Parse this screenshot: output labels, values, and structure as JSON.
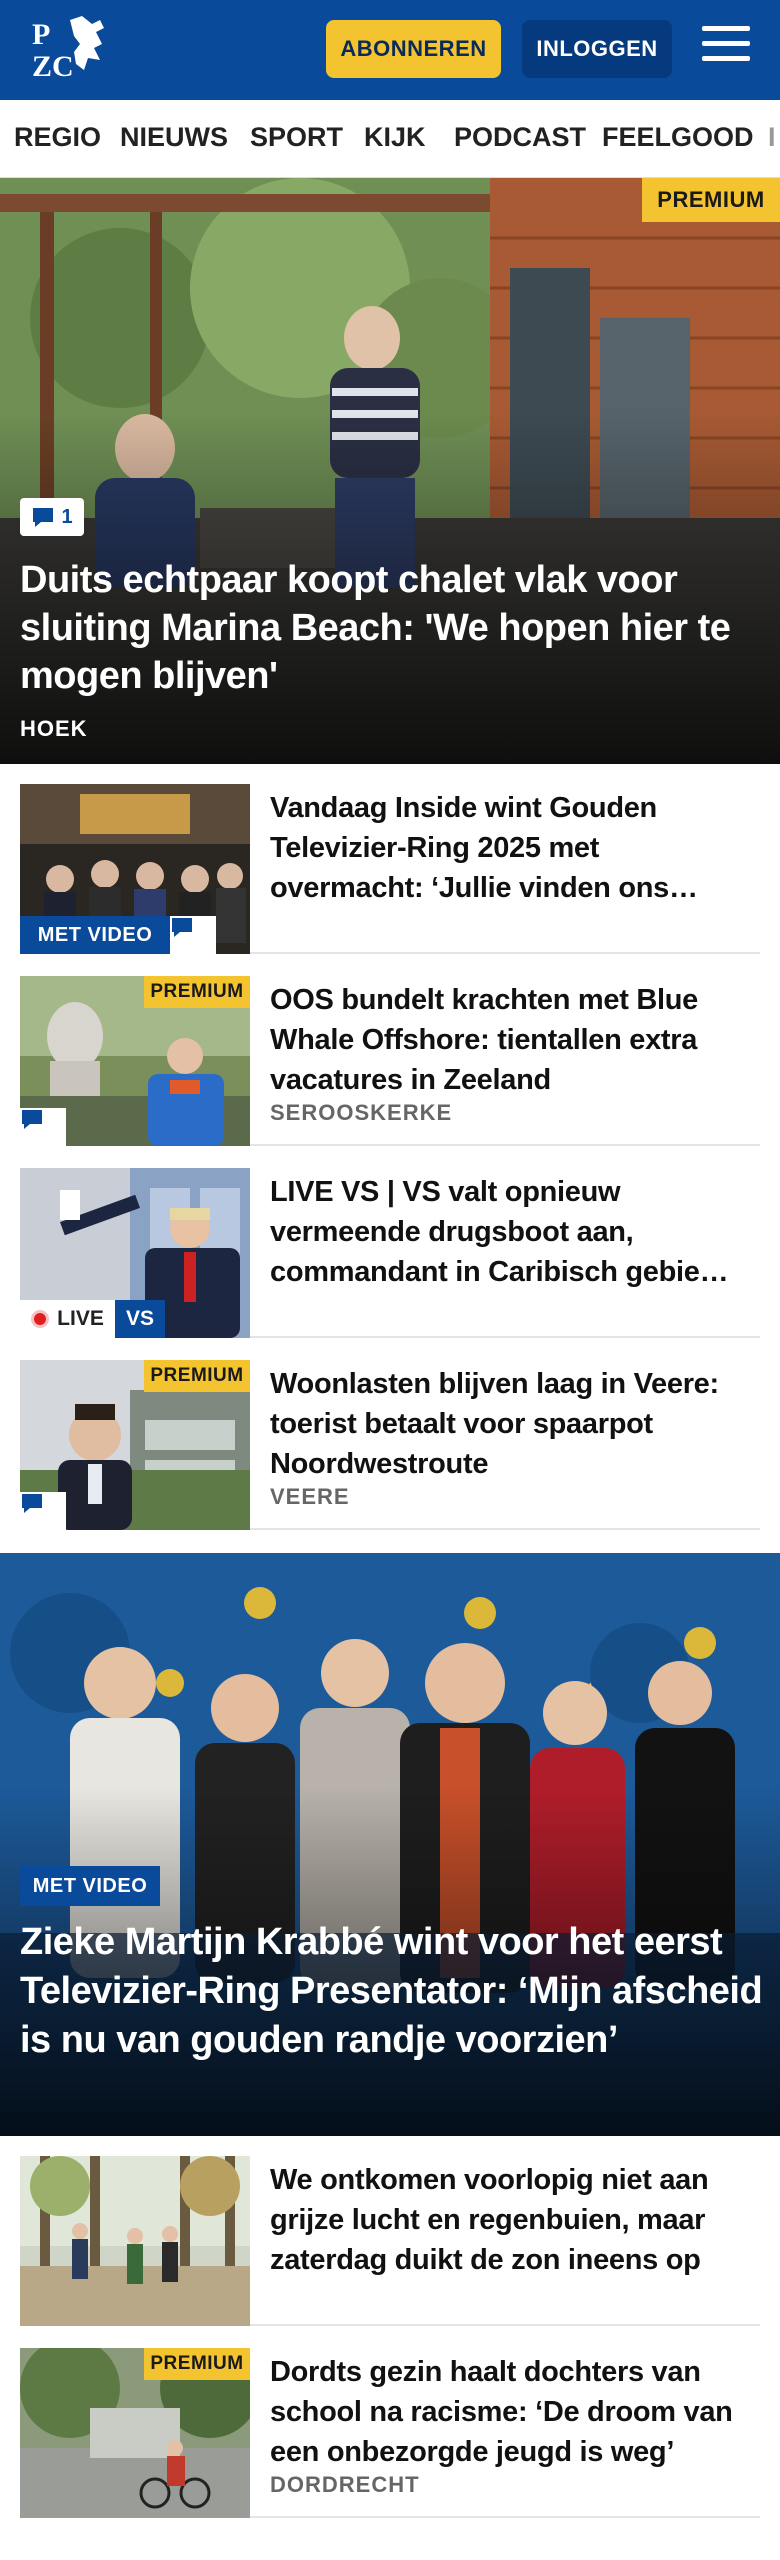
{
  "header": {
    "logo_text": "PZC",
    "subscribe_label": "ABONNEREN",
    "login_label": "INLOGGEN",
    "brand_color": "#0a4a9a",
    "accent_color": "#f4c430"
  },
  "nav": {
    "items": [
      "REGIO",
      "NIEUWS",
      "SPORT",
      "KIJK",
      "PODCAST",
      "FEELGOOD",
      "I"
    ]
  },
  "hero": {
    "premium_label": "PREMIUM",
    "comment_count": "1",
    "title": "Duits echtpaar koopt chalet vlak voor sluiting Marina Beach: 'We hopen hier te mogen blijven'",
    "location": "HOEK"
  },
  "articles": [
    {
      "title": "Vandaag Inside wint Gouden Televizier-Ring 2025 met overmacht: ‘Jullie vinden ons…",
      "video_label": "MET VIDEO",
      "has_comments": true
    },
    {
      "title": "OOS bundelt krachten met Blue Whale Offshore: tientallen extra vacatures in Zeeland",
      "premium_label": "PREMIUM",
      "location": "SEROOSKERKE",
      "has_comments": true
    },
    {
      "title": "LIVE VS | VS valt opnieuw vermeende drugsboot aan, commandant in Caribisch gebie…",
      "live_label": "LIVE",
      "region_label": "VS"
    },
    {
      "title": "Woonlasten blijven laag in Veere: toerist betaalt voor spaarpot Noordwestroute",
      "premium_label": "PREMIUM",
      "location": "VEERE",
      "has_comments": true
    }
  ],
  "feature": {
    "video_label": "MET VIDEO",
    "title": "Zieke Martijn Krabbé wint voor het eerst Televizier-Ring Presentator: ‘Mijn afscheid is nu van gouden randje voorzien’"
  },
  "articles2": [
    {
      "title": "We ontkomen voorlopig niet aan grijze lucht en regenbuien, maar zaterdag duikt de zon ineens op"
    },
    {
      "title": "Dordts gezin haalt dochters van school na racisme: ‘De droom van een onbezorgde jeugd is weg’",
      "premium_label": "PREMIUM",
      "location": "DORDRECHT"
    }
  ]
}
